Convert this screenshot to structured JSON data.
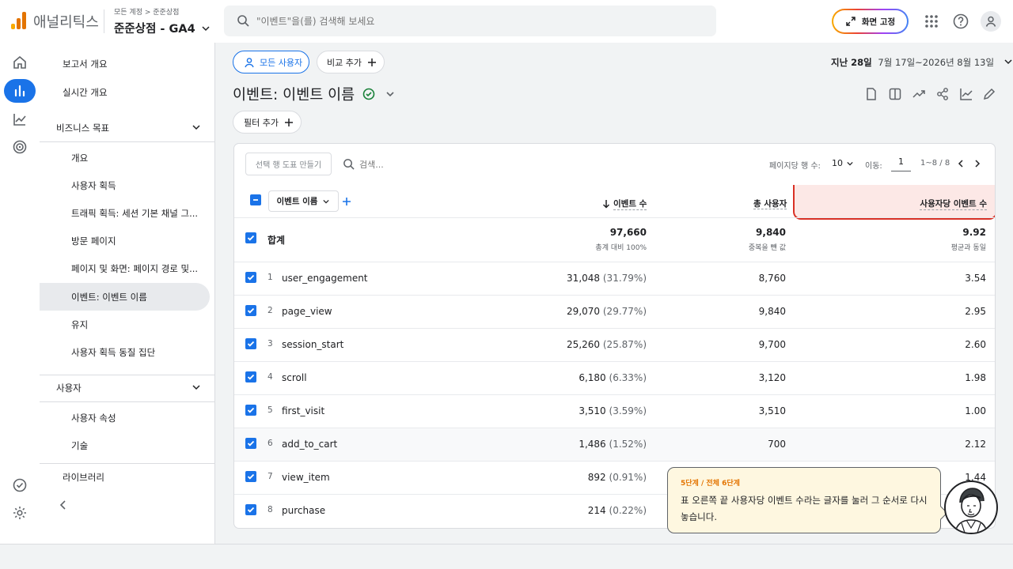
{
  "app": {
    "name": "애널리틱스",
    "breadcrumb": [
      "모든 계정",
      "준준상점"
    ],
    "account": "준준상점 - GA4"
  },
  "search": {
    "placeholder": "\"이벤트\"을(를) 검색해 보세요"
  },
  "topbar": {
    "pin_label": "화면 고정"
  },
  "colors": {
    "accent": "#1a73e8",
    "logo": [
      "#f9ab00",
      "#e37400",
      "#e37400"
    ],
    "highlight_border": "#d93025",
    "highlight_bg": "#fce8e6",
    "tooltip_bg": "#fef7e0",
    "tooltip_step": "#e37400"
  },
  "nav": {
    "report_overview": "보고서 개요",
    "realtime": "실시간 개요",
    "business": {
      "title": "비즈니스 목표",
      "items": [
        "개요",
        "사용자 획득",
        "트래픽 획득: 세션 기본 채널 그...",
        "방문 페이지",
        "페이지 및 화면: 페이지 경로 및...",
        "이벤트: 이벤트 이름",
        "유지",
        "사용자 획득 동질 집단"
      ]
    },
    "user": {
      "title": "사용자",
      "items": [
        "사용자 속성",
        "기술"
      ]
    },
    "library": "라이브러리",
    "active_index": 5
  },
  "filters": {
    "all_users": "모든 사용자",
    "add_comparison": "비교 추가",
    "add_filter": "필터 추가"
  },
  "date": {
    "range_label": "지난 28일",
    "range": "7월 17일~2026년 8월 13일"
  },
  "page": {
    "title": "이벤트: 이벤트 이름"
  },
  "table": {
    "create_chart": "선택 행 도표 만들기",
    "search_placeholder": "검색...",
    "rows_per_page_label": "페이지당 행 수:",
    "rows_per_page": "10",
    "goto_label": "이동:",
    "goto_value": "1",
    "range": "1~8 / 8",
    "dimension": "이벤트 이름",
    "columns": [
      "이벤트 수",
      "총 사용자",
      "사용자당 이벤트 수"
    ],
    "totals": {
      "label": "합계",
      "event_count": "97,660",
      "event_sub": "총계 대비 100%",
      "users": "9,840",
      "users_sub": "중복을 뺀 값",
      "per_user": "9.92",
      "per_user_sub": "평균과 동일"
    },
    "rows": [
      {
        "idx": "1",
        "name": "user_engagement",
        "count": "31,048",
        "pct": "(31.79%)",
        "users": "8,760",
        "per_user": "3.54"
      },
      {
        "idx": "2",
        "name": "page_view",
        "count": "29,070",
        "pct": "(29.77%)",
        "users": "9,840",
        "per_user": "2.95"
      },
      {
        "idx": "3",
        "name": "session_start",
        "count": "25,260",
        "pct": "(25.87%)",
        "users": "9,700",
        "per_user": "2.60"
      },
      {
        "idx": "4",
        "name": "scroll",
        "count": "6,180",
        "pct": "(6.33%)",
        "users": "3,120",
        "per_user": "1.98"
      },
      {
        "idx": "5",
        "name": "first_visit",
        "count": "3,510",
        "pct": "(3.59%)",
        "users": "3,510",
        "per_user": "1.00"
      },
      {
        "idx": "6",
        "name": "add_to_cart",
        "count": "1,486",
        "pct": "(1.52%)",
        "users": "700",
        "per_user": "2.12"
      },
      {
        "idx": "7",
        "name": "view_item",
        "count": "892",
        "pct": "(0.91%)",
        "users": "",
        "per_user": "1.44"
      },
      {
        "idx": "8",
        "name": "purchase",
        "count": "214",
        "pct": "(0.22%)",
        "users": "",
        "per_user": ""
      }
    ]
  },
  "tooltip": {
    "step": "5단계 / 전체 6단계",
    "message": "표 오른쪽 끝 사용자당 이벤트 수라는 글자를 눌러 그 순서로 다시 놓습니다."
  }
}
